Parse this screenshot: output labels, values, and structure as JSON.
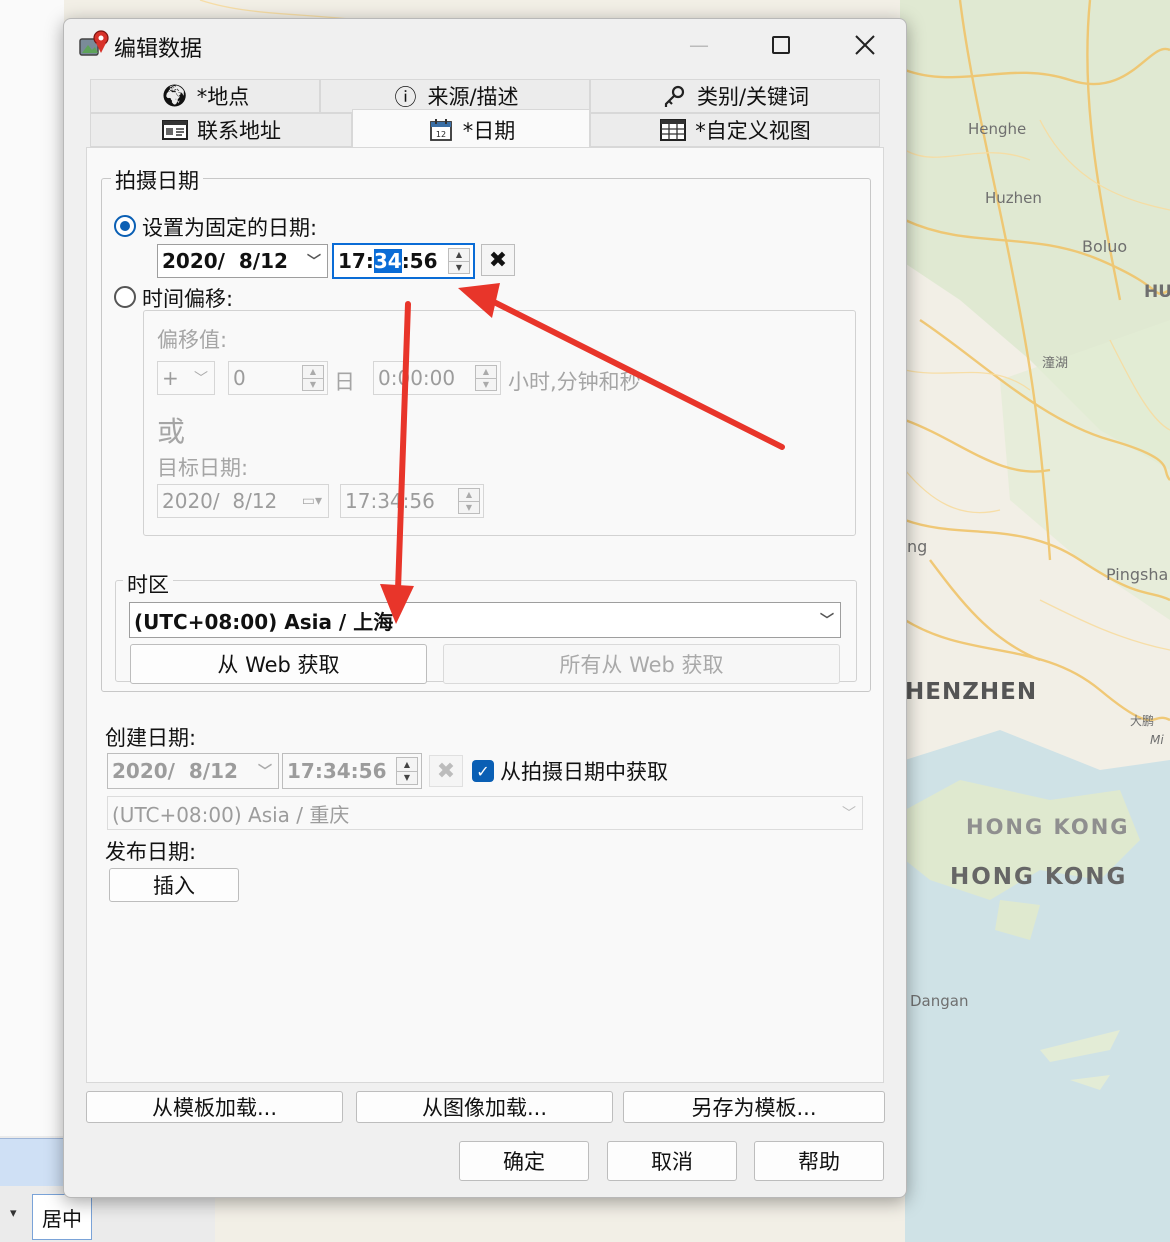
{
  "map": {
    "labels": [
      "Henghe",
      "Huzhen",
      "Boluo",
      "HU",
      "潼湖",
      "ng",
      "Pingsha",
      "HENZHEN",
      "大鹏",
      "Mi",
      "HONG KONG",
      "HONG KONG",
      "Dangan"
    ]
  },
  "taskbar": {
    "center_label": "居中",
    "dropdown_icon": "caret-down-icon"
  },
  "dialog": {
    "title": "编辑数据",
    "tabs": [
      {
        "label": "*地点",
        "icon": "globe-icon"
      },
      {
        "label": "来源/描述",
        "icon": "info-icon"
      },
      {
        "label": "类别/关键词",
        "icon": "key-icon"
      },
      {
        "label": "联系地址",
        "icon": "address-card-icon"
      },
      {
        "label": "*日期",
        "icon": "calendar-icon"
      },
      {
        "label": "*自定义视图",
        "icon": "table-view-icon"
      }
    ],
    "shoot_date": {
      "legend": "拍摄日期",
      "fixed_radio_label": "设置为固定的日期:",
      "date_value": "2020/  8/12",
      "time_pre": "17:",
      "time_sel": "34",
      "time_post": ":56",
      "offset_radio_label": "时间偏移:",
      "offset_label": "偏移值:",
      "sign_value": "+",
      "days_value": "0",
      "days_unit": "日",
      "hms_value": "0:00:00",
      "hms_unit": "小时,分钟和秒",
      "or_label": "或",
      "target_label": "目标日期:",
      "target_date": "2020/  8/12",
      "target_time": "17:34:56",
      "timezone_legend": "时区",
      "timezone_value": "(UTC+08:00) Asia / 上海",
      "from_web_button": "从 Web 获取",
      "all_from_web_button": "所有从 Web 获取"
    },
    "create_date": {
      "label": "创建日期:",
      "date_value": "2020/  8/12",
      "time_value": "17:34:56",
      "from_shoot_label": "从拍摄日期中获取",
      "timezone_value": "(UTC+08:00) Asia / 重庆"
    },
    "publish_date": {
      "label": "发布日期:",
      "insert_button": "插入"
    },
    "footer": {
      "load_template": "从模板加载...",
      "load_image": "从图像加载...",
      "save_template": "另存为模板...",
      "ok": "确定",
      "cancel": "取消",
      "help": "帮助"
    }
  },
  "colors": {
    "accent": "#0a6cd6",
    "arrow": "#e8352a",
    "map_road": "#f3c870",
    "map_water": "#c9dde3",
    "map_green": "#d7e6c6"
  }
}
